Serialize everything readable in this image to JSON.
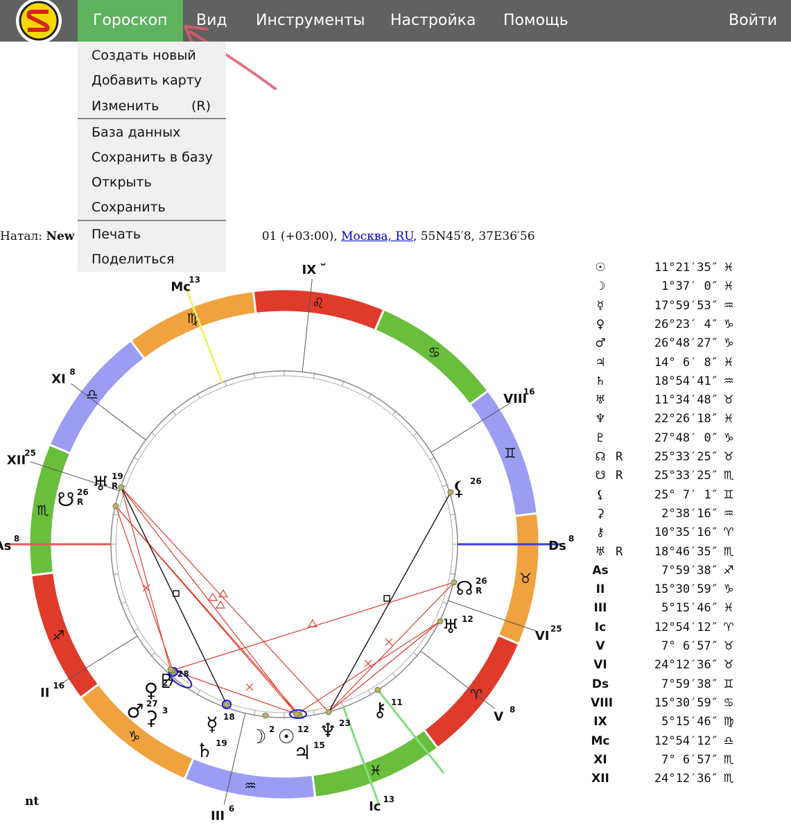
{
  "navbar": {
    "items": [
      {
        "label": "Гороскоп",
        "active": true
      },
      {
        "label": "Вид"
      },
      {
        "label": "Инструменты"
      },
      {
        "label": "Настройка"
      },
      {
        "label": "Помощь"
      }
    ],
    "login_label": "Войти"
  },
  "menu": {
    "create_new": "Создать новый",
    "add_chart": "Добавить карту",
    "edit": "Изменить",
    "edit_key": "(R)",
    "database": "База данных",
    "save_to_db": "Сохранить в базу",
    "open": "Открыть",
    "save": "Сохранить",
    "print": "Печать",
    "share": "Поделиться"
  },
  "natal": {
    "prefix": "Натал:",
    "name_fragment": "New c",
    "time_fragment": "01 (+03:00),",
    "place": "Москва, RU",
    "coords": ", 55N45′8, 37E36′56"
  },
  "positions": [
    {
      "glyph": "☉",
      "r": "",
      "value": "11°21′35″",
      "sign": "♓"
    },
    {
      "glyph": "☽",
      "r": "",
      "value": "1°37′ 0″",
      "sign": "♓"
    },
    {
      "glyph": "☿",
      "r": "",
      "value": "17°59′53″",
      "sign": "♒"
    },
    {
      "glyph": "♀",
      "r": "",
      "value": "26°23′ 4″",
      "sign": "♑"
    },
    {
      "glyph": "♂",
      "r": "",
      "value": "26°48′27″",
      "sign": "♑"
    },
    {
      "glyph": "♃",
      "r": "",
      "value": "14° 6′ 8″",
      "sign": "♓"
    },
    {
      "glyph": "♄",
      "r": "",
      "value": "18°54′41″",
      "sign": "♒"
    },
    {
      "glyph": "♅",
      "r": "",
      "value": "11°34′48″",
      "sign": "♉"
    },
    {
      "glyph": "♆",
      "r": "",
      "value": "22°26′18″",
      "sign": "♓"
    },
    {
      "glyph": "♇",
      "r": "",
      "value": "27°48′ 0″",
      "sign": "♑"
    },
    {
      "glyph": "☊",
      "r": "R",
      "value": "25°33′25″",
      "sign": "♉"
    },
    {
      "glyph": "☋",
      "r": "R",
      "value": "25°33′25″",
      "sign": "♏"
    },
    {
      "glyph": "⚸",
      "r": "",
      "value": "25° 7′ 1″",
      "sign": "♊"
    },
    {
      "glyph": "⚳",
      "r": "",
      "value": "2°38′16″",
      "sign": "♒"
    },
    {
      "glyph": "⚷",
      "r": "",
      "value": "10°35′16″",
      "sign": "♈"
    },
    {
      "glyph": "♅",
      "r": "R",
      "value": "18°46′35″",
      "sign": "♏"
    },
    {
      "glyph": "As",
      "r": "",
      "value": "7°59′38″",
      "sign": "♐"
    },
    {
      "glyph": "II",
      "r": "",
      "value": "15°30′59″",
      "sign": "♑"
    },
    {
      "glyph": "III",
      "r": "",
      "value": "5°15′46″",
      "sign": "♓"
    },
    {
      "glyph": "Ic",
      "r": "",
      "value": "12°54′12″",
      "sign": "♈"
    },
    {
      "glyph": "V",
      "r": "",
      "value": "7° 6′57″",
      "sign": "♉"
    },
    {
      "glyph": "VI",
      "r": "",
      "value": "24°12′36″",
      "sign": "♉"
    },
    {
      "glyph": "Ds",
      "r": "",
      "value": "7°59′38″",
      "sign": "♊"
    },
    {
      "glyph": "VIII",
      "r": "",
      "value": "15°30′59″",
      "sign": "♋"
    },
    {
      "glyph": "IX",
      "r": "",
      "value": "5°15′46″",
      "sign": "♍"
    },
    {
      "glyph": "Mc",
      "r": "",
      "value": "12°54′12″",
      "sign": "♎"
    },
    {
      "glyph": "XI",
      "r": "",
      "value": "7° 6′57″",
      "sign": "♏"
    },
    {
      "glyph": "XII",
      "r": "",
      "value": "24°12′36″",
      "sign": "♏"
    }
  ],
  "wheel": {
    "signs": [
      "♈",
      "♉",
      "♊",
      "♋",
      "♌",
      "♍",
      "♎",
      "♏",
      "♐",
      "♑",
      "♒",
      "♓"
    ],
    "sign_colors": [
      "#e03a2a",
      "#f0a23f",
      "#9b9cf2",
      "#69be3c",
      "#e03a2a",
      "#f0a23f",
      "#9b9cf2",
      "#69be3c",
      "#e03a2a",
      "#f0a23f",
      "#9b9cf2",
      "#69be3c"
    ],
    "houses": [
      {
        "label": "As",
        "deg": "8"
      },
      {
        "label": "II",
        "deg": "16"
      },
      {
        "label": "III",
        "deg": "6"
      },
      {
        "label": "Ic",
        "deg": "13"
      },
      {
        "label": "V",
        "deg": "8"
      },
      {
        "label": "VI",
        "deg": "25"
      },
      {
        "label": "Ds",
        "deg": "8"
      },
      {
        "label": "VIII",
        "deg": "16"
      },
      {
        "label": "IX",
        "deg": "6"
      },
      {
        "label": "Mc",
        "deg": "13"
      },
      {
        "label": "XI",
        "deg": "8"
      },
      {
        "label": "XII",
        "deg": "25"
      }
    ],
    "planets": [
      {
        "glyph": "♅",
        "deg": "19",
        "r": "R"
      },
      {
        "glyph": "☋",
        "deg": "26",
        "r": "R"
      },
      {
        "glyph": "⚸",
        "deg": "26",
        "r": ""
      },
      {
        "glyph": "☊",
        "deg": "26",
        "r": "R"
      },
      {
        "glyph": "♅",
        "deg": "12",
        "r": ""
      },
      {
        "glyph": "⚷",
        "deg": "11",
        "r": ""
      },
      {
        "glyph": "♆",
        "deg": "23",
        "r": ""
      },
      {
        "glyph": "♃",
        "deg": "15",
        "r": ""
      },
      {
        "glyph": "☉",
        "deg": "12",
        "r": ""
      },
      {
        "glyph": "☽",
        "deg": "2",
        "r": ""
      },
      {
        "glyph": "☿",
        "deg": "18",
        "r": ""
      },
      {
        "glyph": "♄",
        "deg": "19",
        "r": ""
      },
      {
        "glyph": "⚳",
        "deg": "3",
        "r": ""
      },
      {
        "glyph": "♂",
        "deg": "27",
        "r": ""
      },
      {
        "glyph": "♀",
        "deg": "27",
        "r": ""
      },
      {
        "glyph": "♇",
        "deg": "28",
        "r": ""
      }
    ]
  },
  "footer_fragment": "nt"
}
